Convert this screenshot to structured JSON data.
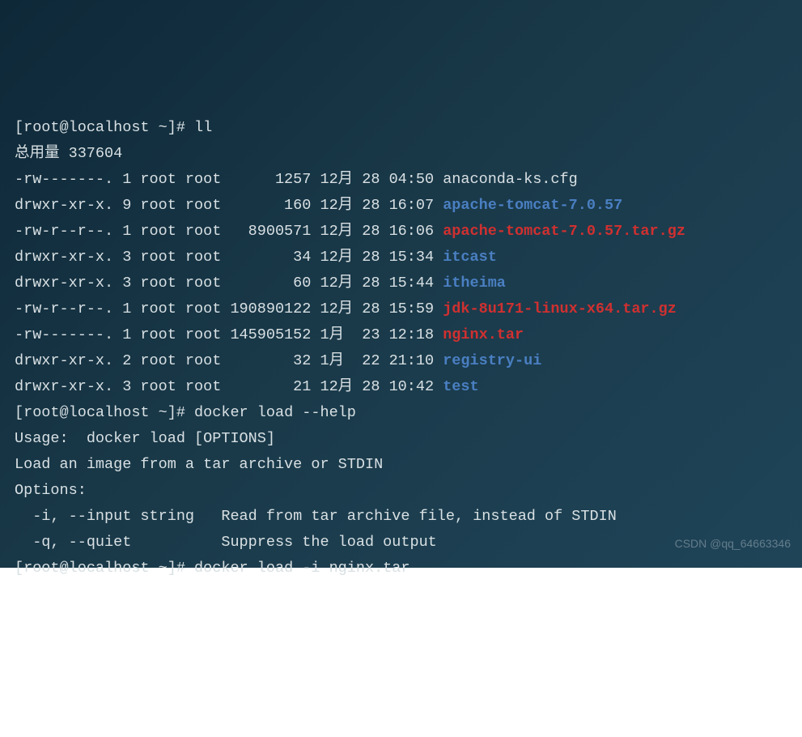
{
  "prompt1": "[root@localhost ~]# ",
  "cmd1": "ll",
  "total_line": "总用量 337604",
  "files": [
    {
      "perm": "-rw-------.",
      "links": "1",
      "owner": "root",
      "group": "root",
      "size": "1257",
      "month": "12月",
      "day": "28",
      "time": "04:50",
      "name": "anaconda-ks.cfg",
      "color": "fg-white"
    },
    {
      "perm": "drwxr-xr-x.",
      "links": "9",
      "owner": "root",
      "group": "root",
      "size": "160",
      "month": "12月",
      "day": "28",
      "time": "16:07",
      "name": "apache-tomcat-7.0.57",
      "color": "fg-blue"
    },
    {
      "perm": "-rw-r--r--.",
      "links": "1",
      "owner": "root",
      "group": "root",
      "size": "8900571",
      "month": "12月",
      "day": "28",
      "time": "16:06",
      "name": "apache-tomcat-7.0.57.tar.gz",
      "color": "fg-red"
    },
    {
      "perm": "drwxr-xr-x.",
      "links": "3",
      "owner": "root",
      "group": "root",
      "size": "34",
      "month": "12月",
      "day": "28",
      "time": "15:34",
      "name": "itcast",
      "color": "fg-blue"
    },
    {
      "perm": "drwxr-xr-x.",
      "links": "3",
      "owner": "root",
      "group": "root",
      "size": "60",
      "month": "12月",
      "day": "28",
      "time": "15:44",
      "name": "itheima",
      "color": "fg-blue"
    },
    {
      "perm": "-rw-r--r--.",
      "links": "1",
      "owner": "root",
      "group": "root",
      "size": "190890122",
      "month": "12月",
      "day": "28",
      "time": "15:59",
      "name": "jdk-8u171-linux-x64.tar.gz",
      "color": "fg-red"
    },
    {
      "perm": "-rw-------.",
      "links": "1",
      "owner": "root",
      "group": "root",
      "size": "145905152",
      "month": "1月 ",
      "day": "23",
      "time": "12:18",
      "name": "nginx.tar",
      "color": "fg-red"
    },
    {
      "perm": "drwxr-xr-x.",
      "links": "2",
      "owner": "root",
      "group": "root",
      "size": "32",
      "month": "1月 ",
      "day": "22",
      "time": "21:10",
      "name": "registry-ui",
      "color": "fg-blue"
    },
    {
      "perm": "drwxr-xr-x.",
      "links": "3",
      "owner": "root",
      "group": "root",
      "size": "21",
      "month": "12月",
      "day": "28",
      "time": "10:42",
      "name": "test",
      "color": "fg-blue"
    }
  ],
  "prompt2": "[root@localhost ~]# ",
  "cmd2": "docker load --help",
  "blank1": "",
  "usage_line": "Usage:  docker load [OPTIONS]",
  "blank2": "",
  "desc_line": "Load an image from a tar archive or STDIN",
  "blank3": "",
  "options_header": "Options:",
  "opt1": "  -i, --input string   Read from tar archive file, instead of STDIN",
  "opt2": "  -q, --quiet          Suppress the load output",
  "prompt3": "[root@localhost ~]# ",
  "cmd3": "docker load -i nginx.tar",
  "watermark": "CSDN @qq_64663346"
}
